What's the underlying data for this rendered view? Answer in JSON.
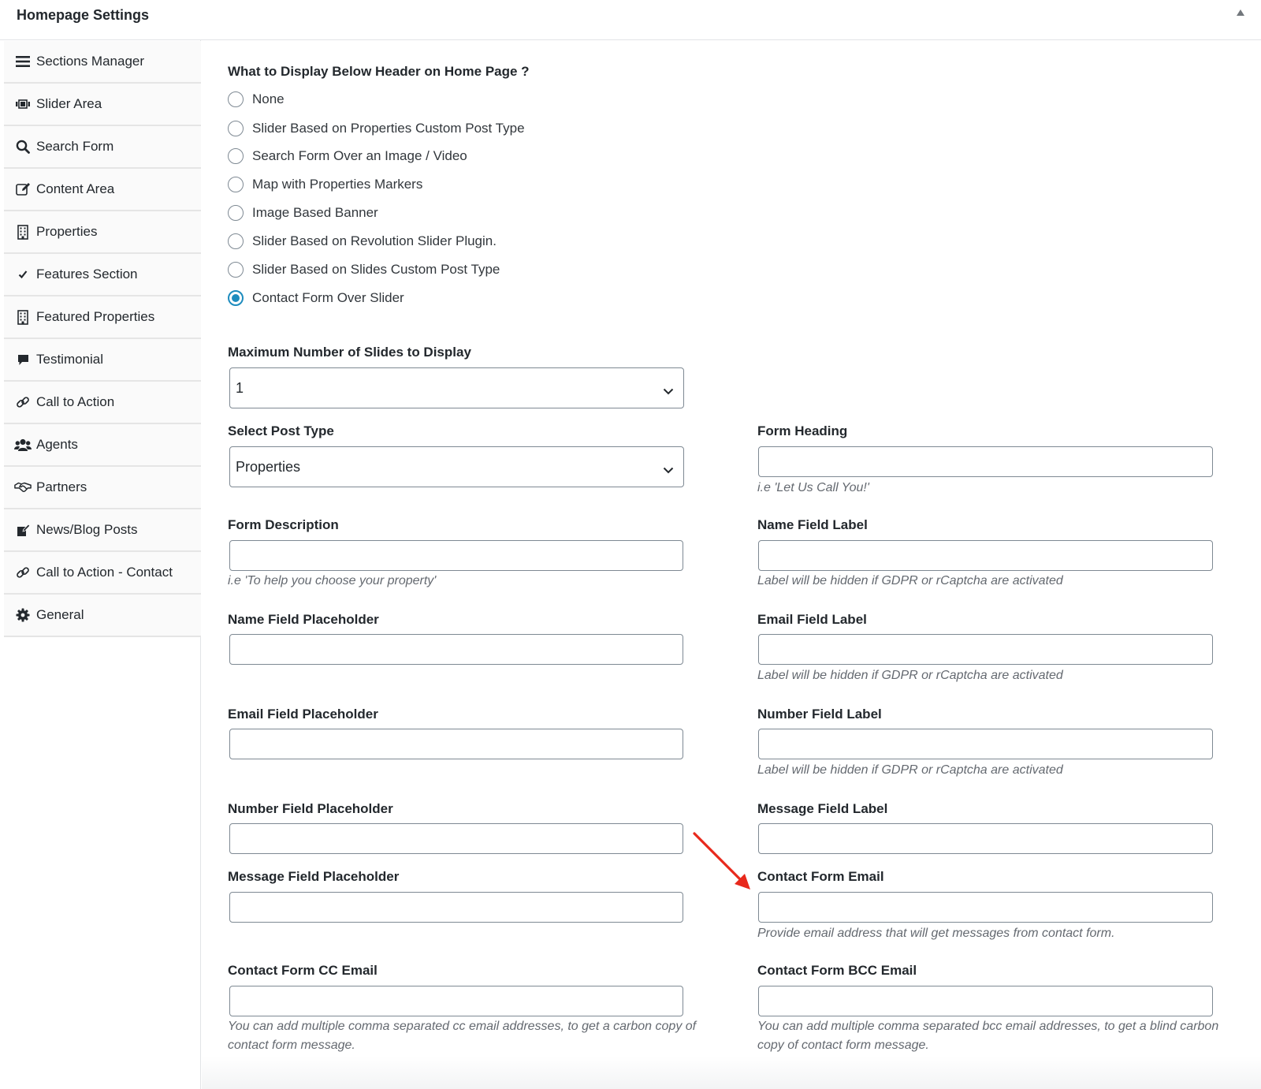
{
  "header": {
    "title": "Homepage Settings"
  },
  "sidebar": {
    "items": [
      {
        "label": "Sections Manager",
        "icon": "menu-icon"
      },
      {
        "label": "Slider Area",
        "icon": "slider-icon"
      },
      {
        "label": "Search Form",
        "icon": "search-icon"
      },
      {
        "label": "Content Area",
        "icon": "edit-icon"
      },
      {
        "label": "Properties",
        "icon": "building-icon"
      },
      {
        "label": "Features Section",
        "icon": "checkmark-icon"
      },
      {
        "label": "Featured Properties",
        "icon": "building-icon"
      },
      {
        "label": "Testimonial",
        "icon": "speech-bubble-icon"
      },
      {
        "label": "Call to Action",
        "icon": "link-icon"
      },
      {
        "label": "Agents",
        "icon": "users-icon"
      },
      {
        "label": "Partners",
        "icon": "handshake-icon"
      },
      {
        "label": "News/Blog Posts",
        "icon": "pen-icon"
      },
      {
        "label": "Call to Action - Contact",
        "icon": "link-icon"
      },
      {
        "label": "General",
        "icon": "gear-icon"
      }
    ]
  },
  "display_below_header": {
    "label": "What to Display Below Header on Home Page ?",
    "selected": "Contact Form Over Slider",
    "options": [
      "None",
      "Slider Based on Properties Custom Post Type",
      "Search Form Over an Image / Video",
      "Map with Properties Markers",
      "Image Based Banner",
      "Slider Based on Revolution Slider Plugin.",
      "Slider Based on Slides Custom Post Type",
      "Contact Form Over Slider"
    ]
  },
  "max_slides": {
    "label": "Maximum Number of Slides to Display",
    "value": "1"
  },
  "post_type": {
    "label": "Select Post Type",
    "value": "Properties"
  },
  "fields": {
    "form_heading": {
      "label": "Form Heading",
      "value": "",
      "desc": "i.e 'Let Us Call You!'"
    },
    "form_description": {
      "label": "Form Description",
      "value": "",
      "desc": "i.e 'To help you choose your property'"
    },
    "name_label": {
      "label": "Name Field Label",
      "value": "",
      "desc": "Label will be hidden if GDPR or rCaptcha are activated"
    },
    "name_placeholder": {
      "label": "Name Field Placeholder",
      "value": ""
    },
    "email_label": {
      "label": "Email Field Label",
      "value": "",
      "desc": "Label will be hidden if GDPR or rCaptcha are activated"
    },
    "email_placeholder": {
      "label": "Email Field Placeholder",
      "value": ""
    },
    "number_label": {
      "label": "Number Field Label",
      "value": "",
      "desc": "Label will be hidden if GDPR or rCaptcha are activated"
    },
    "number_placeholder": {
      "label": "Number Field Placeholder",
      "value": ""
    },
    "message_label": {
      "label": "Message Field Label",
      "value": ""
    },
    "message_placeholder": {
      "label": "Message Field Placeholder",
      "value": ""
    },
    "contact_email": {
      "label": "Contact Form Email",
      "value": "",
      "desc": "Provide email address that will get messages from contact form."
    },
    "cc_email": {
      "label": "Contact Form CC Email",
      "value": "",
      "desc": "You can add multiple comma separated cc email addresses, to get a carbon copy of contact form message."
    },
    "bcc_email": {
      "label": "Contact Form BCC Email",
      "value": "",
      "desc": "You can add multiple comma separated bcc email addresses, to get a blind carbon copy of contact form message."
    }
  },
  "colors": {
    "accent": "#1e8cbe",
    "annotation_arrow": "#e8291c",
    "border": "#7e8993"
  }
}
